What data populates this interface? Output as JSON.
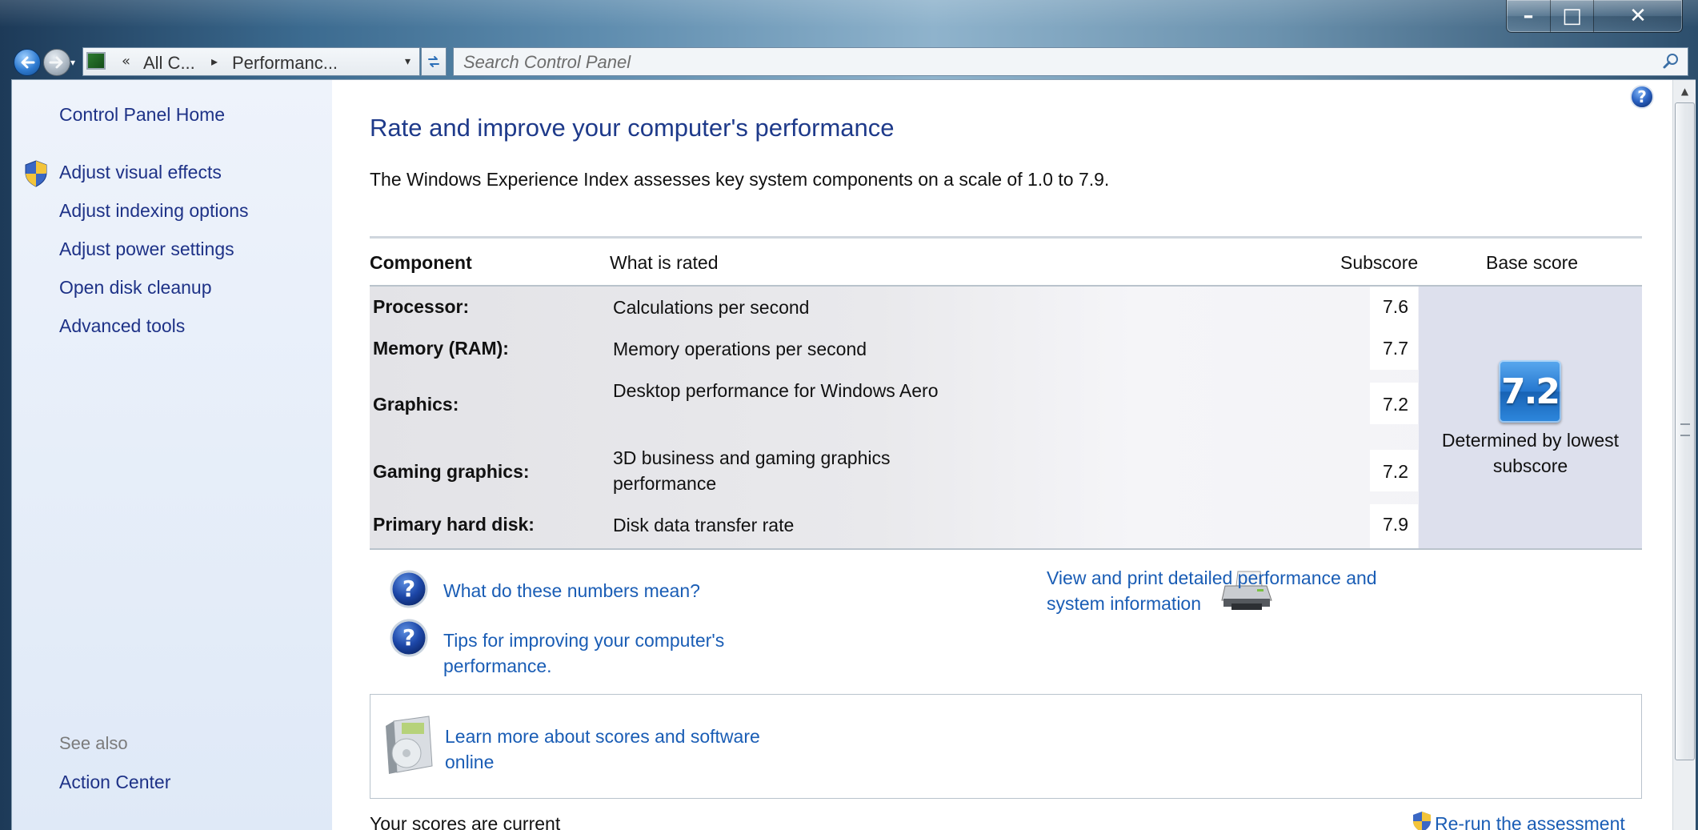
{
  "window": {
    "caption_buttons": {
      "minimize": "–",
      "maximize": "□",
      "close": "✕"
    }
  },
  "navigation": {
    "back_icon": "back-arrow-icon",
    "forward_icon": "forward-arrow-icon",
    "address": {
      "overflow": "«",
      "segment1": "All C...",
      "separator": "▸",
      "segment2": "Performanc...",
      "dropdown": "▾"
    },
    "refresh_icon": "refresh-icon",
    "search": {
      "placeholder": "Search Control Panel"
    }
  },
  "sidebar": {
    "home": "Control Panel Home",
    "tasks": [
      "Adjust visual effects",
      "Adjust indexing options",
      "Adjust power settings",
      "Open disk cleanup",
      "Advanced tools"
    ],
    "see_also_heading": "See also",
    "see_also": [
      "Action Center"
    ]
  },
  "main": {
    "title": "Rate and improve your computer's performance",
    "intro": "The Windows Experience Index assesses key system components on a scale of 1.0 to 7.9.",
    "table": {
      "headers": {
        "component": "Component",
        "what": "What is rated",
        "subscore": "Subscore",
        "base": "Base score"
      },
      "rows": [
        {
          "component": "Processor:",
          "what": "Calculations per second",
          "subscore": "7.6"
        },
        {
          "component": "Memory (RAM):",
          "what": "Memory operations per second",
          "subscore": "7.7"
        },
        {
          "component": "Graphics:",
          "what": "Desktop performance for Windows Aero",
          "subscore": "7.2"
        },
        {
          "component": "Gaming graphics:",
          "what": "3D business and gaming graphics performance",
          "subscore": "7.2"
        },
        {
          "component": "Primary hard disk:",
          "what": "Disk data transfer rate",
          "subscore": "7.9"
        }
      ],
      "base_score": "7.2",
      "base_caption": "Determined by lowest subscore"
    },
    "links": {
      "numbers": "What do these numbers mean?",
      "tips": "Tips for improving your computer's performance.",
      "print": "View and print detailed performance and system information",
      "learn": "Learn more about scores and software online"
    },
    "status": "Your scores are current",
    "rerun": "Re-run the assessment"
  },
  "colors": {
    "link": "#1a5db5",
    "title": "#1e3a8a",
    "sidebar_link": "#1e3287",
    "base_panel": "#dde0ed"
  }
}
